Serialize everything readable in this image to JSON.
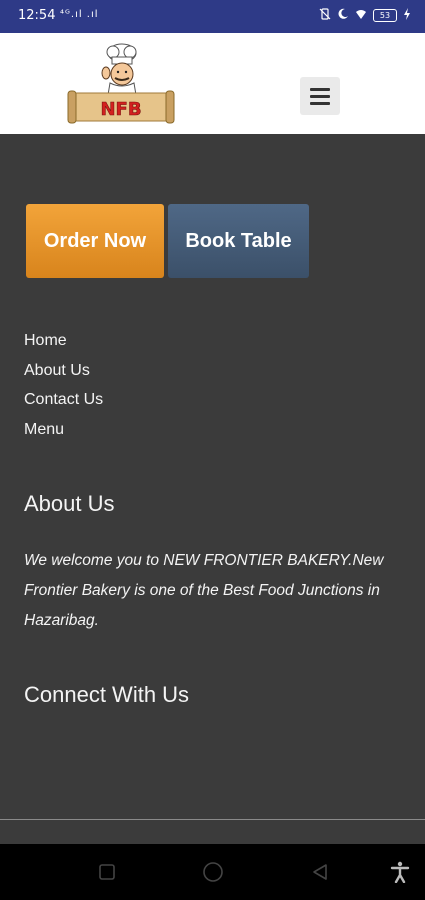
{
  "status_bar": {
    "time": "12:54",
    "signal_text": "⁴ᴳ.ıl .ıl",
    "battery": "53",
    "icons": [
      "vibrate-off-icon",
      "moon-icon",
      "wifi-icon",
      "battery-icon",
      "charging-icon"
    ]
  },
  "header": {
    "logo_text": "NFB",
    "menu_icon": "hamburger-menu-icon"
  },
  "cta": {
    "order_label": "Order Now",
    "book_label": "Book Table",
    "order_color": "#e2901f",
    "book_color": "#465c77"
  },
  "nav_links": [
    "Home",
    "About Us",
    "Contact Us",
    "Menu"
  ],
  "about": {
    "heading": "About Us",
    "text": "We welcome you to NEW FRONTIER BAKERY.New Frontier Bakery is one of the Best Food Junctions in Hazaribag."
  },
  "connect": {
    "heading": "Connect With Us"
  },
  "system_nav": {
    "icons": [
      "recent-apps-icon",
      "home-icon",
      "back-icon",
      "accessibility-icon"
    ]
  }
}
